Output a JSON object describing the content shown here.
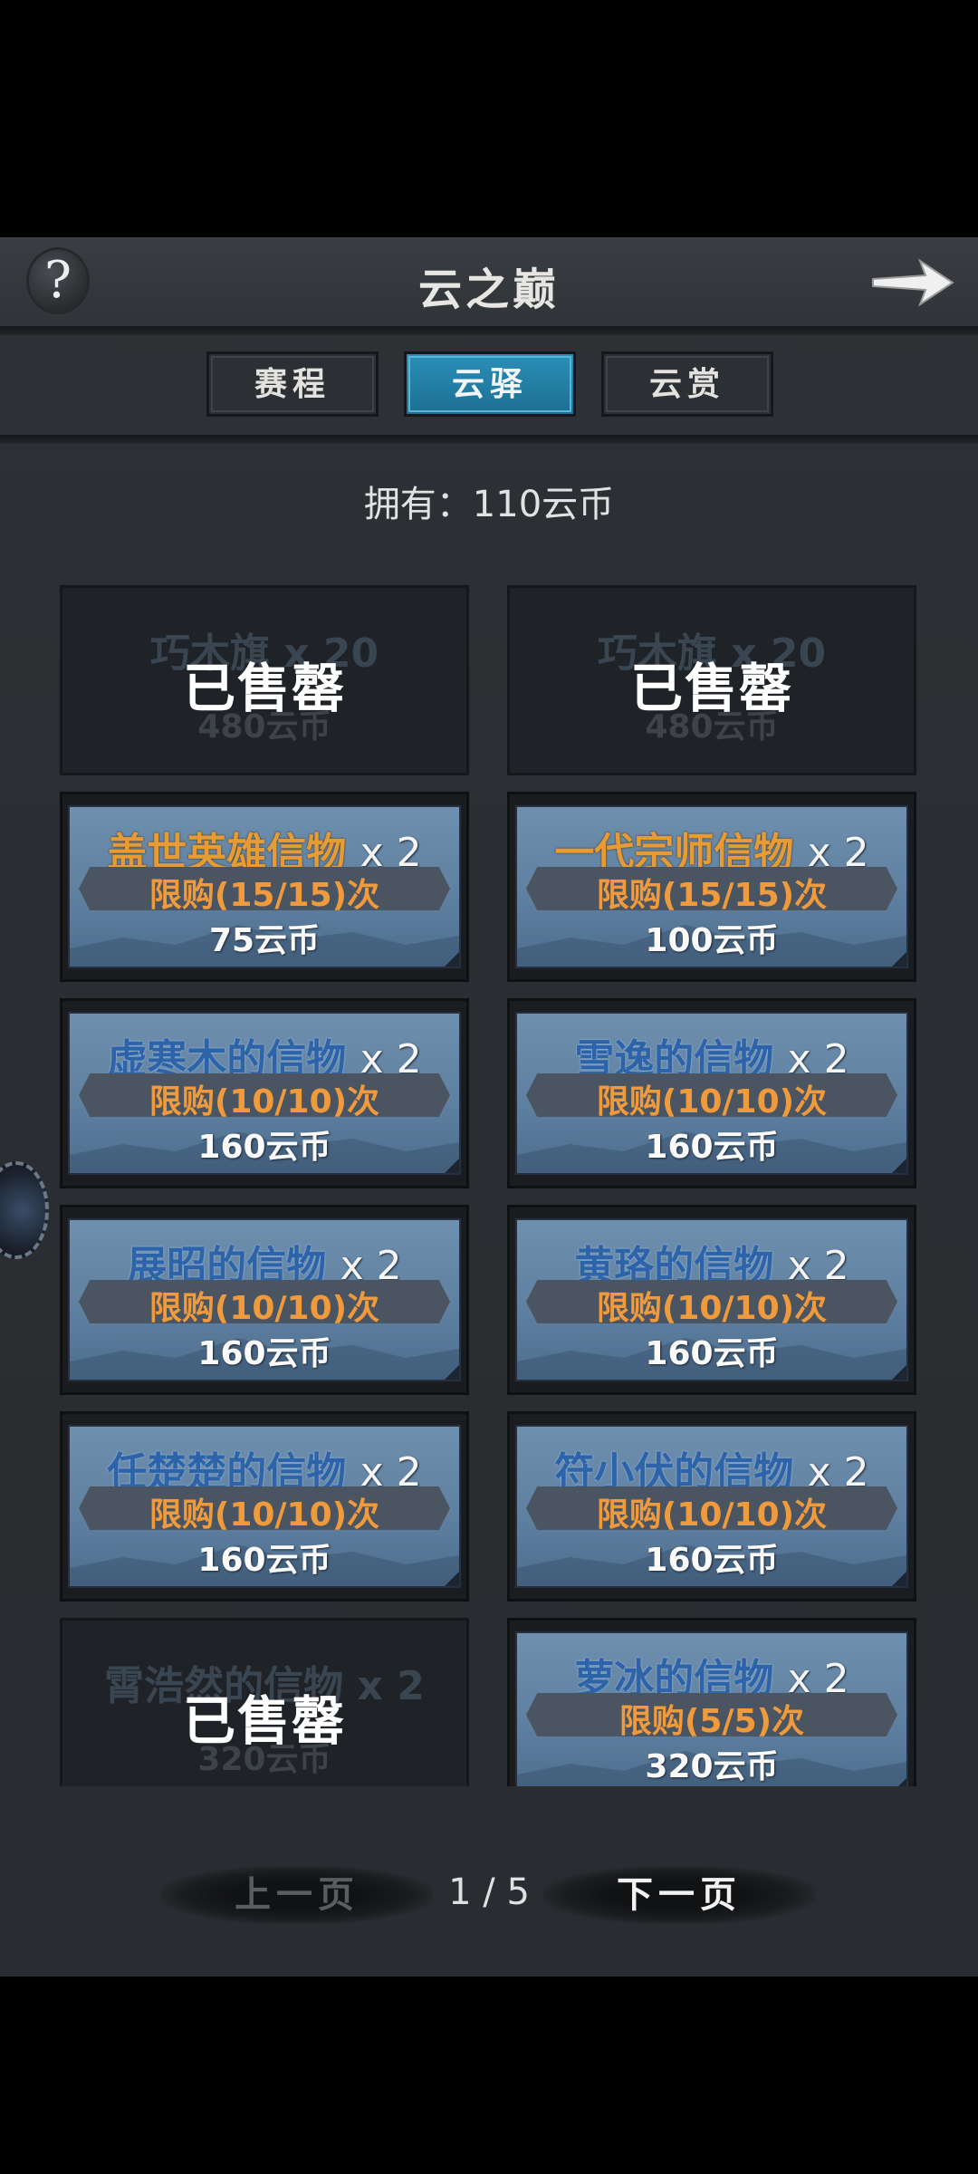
{
  "header": {
    "title": "云之巅",
    "help_icon": "?"
  },
  "tabs": [
    {
      "label": "赛程",
      "active": false
    },
    {
      "label": "云驿",
      "active": true
    },
    {
      "label": "云赏",
      "active": false
    }
  ],
  "balance": "拥有：110云币",
  "sold_out_label": "已售罄",
  "items": [
    {
      "name": "巧木旗",
      "qty": "x 20",
      "limit": "",
      "price": "480云币",
      "sold": true
    },
    {
      "name": "巧木旗",
      "qty": "x 20",
      "limit": "",
      "price": "480云币",
      "sold": true
    },
    {
      "name": "盖世英雄信物",
      "qty": "x 2",
      "limit": "限购(15/15)次",
      "price": "75云币",
      "sold": false,
      "gold": true
    },
    {
      "name": "一代宗师信物",
      "qty": "x 2",
      "limit": "限购(15/15)次",
      "price": "100云币",
      "sold": false,
      "gold": true
    },
    {
      "name": "虚寒木的信物",
      "qty": "x 2",
      "limit": "限购(10/10)次",
      "price": "160云币",
      "sold": false
    },
    {
      "name": "雪逸的信物",
      "qty": "x 2",
      "limit": "限购(10/10)次",
      "price": "160云币",
      "sold": false
    },
    {
      "name": "展昭的信物",
      "qty": "x 2",
      "limit": "限购(10/10)次",
      "price": "160云币",
      "sold": false
    },
    {
      "name": "黄珞的信物",
      "qty": "x 2",
      "limit": "限购(10/10)次",
      "price": "160云币",
      "sold": false
    },
    {
      "name": "任楚楚的信物",
      "qty": "x 2",
      "limit": "限购(10/10)次",
      "price": "160云币",
      "sold": false
    },
    {
      "name": "符小伏的信物",
      "qty": "x 2",
      "limit": "限购(10/10)次",
      "price": "160云币",
      "sold": false
    },
    {
      "name": "霄浩然的信物",
      "qty": "x 2",
      "limit": "",
      "price": "320云币",
      "sold": true
    },
    {
      "name": "萝冰的信物",
      "qty": "x 2",
      "limit": "限购(5/5)次",
      "price": "320云币",
      "sold": false
    }
  ],
  "pager": {
    "prev": "上一页",
    "page": "1 / 5",
    "next": "下一页"
  },
  "colors": {
    "accent_tab": "#2a8fb8",
    "limit_text": "#ef9a3c",
    "blue_name": "#2d63a8",
    "gold_name": "#e69b34"
  }
}
